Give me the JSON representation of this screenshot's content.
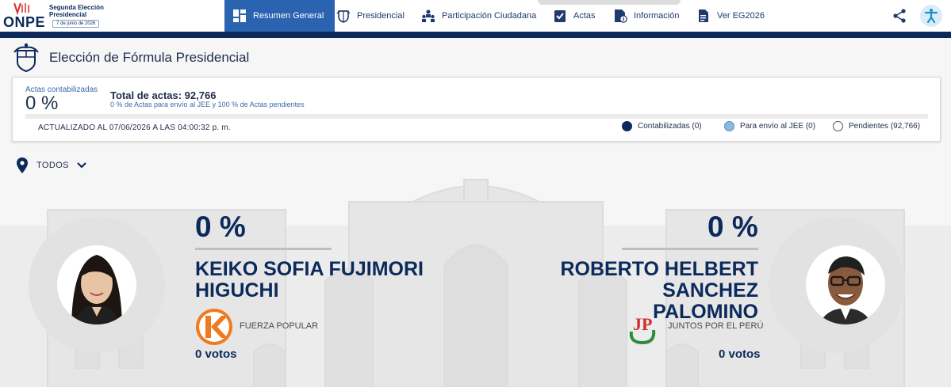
{
  "logo": {
    "brand": "ONPE",
    "line1": "Segunda Elección",
    "line2": "Presidencial",
    "date": "7 de junio de 2026"
  },
  "nav": {
    "items": [
      {
        "label": "Resumen General",
        "icon": "dashboard-icon"
      },
      {
        "label": "Presidencial",
        "icon": "coat-of-arms-icon"
      },
      {
        "label": "Participación Ciudadana",
        "icon": "people-icon"
      },
      {
        "label": "Actas",
        "icon": "clipboard-check-icon"
      },
      {
        "label": "Información",
        "icon": "info-document-icon"
      },
      {
        "label": "Ver EG2026",
        "icon": "document-icon"
      }
    ],
    "active_index": 0
  },
  "page": {
    "title": "Elección de Fórmula Presidencial"
  },
  "summary": {
    "actas_label": "Actas contabilizadas",
    "actas_pct": "0 %",
    "total_label": "Total de actas: 92,766",
    "sub_label": "0 % de Actas para envío al JEE y 100 % de Actas pendientes",
    "progress_fraction": 0,
    "updated": "ACTUALIZADO AL 07/06/2026 A LAS 04:00:32 p. m.",
    "legend": [
      {
        "label": "Contabilizadas (0)",
        "color": "#0b2a5b"
      },
      {
        "label": "Para envío al JEE (0)",
        "color": "#8fb8de"
      },
      {
        "label": "Pendientes (92,766)",
        "color": "#ffffff"
      }
    ]
  },
  "filter": {
    "label": "TODOS"
  },
  "candidates": [
    {
      "pct": "0 %",
      "name_line1": "KEIKO SOFIA FUJIMORI",
      "name_line2": "HIGUCHI",
      "party": "FUERZA POPULAR",
      "party_color": "#f07a1f",
      "votes": "0 votos"
    },
    {
      "pct": "0 %",
      "name_line1": "ROBERTO HELBERT SANCHEZ",
      "name_line2": "PALOMINO",
      "party": "JUNTOS POR EL PERÚ",
      "party_color": "#d42b2b",
      "votes": "0 votos"
    }
  ]
}
